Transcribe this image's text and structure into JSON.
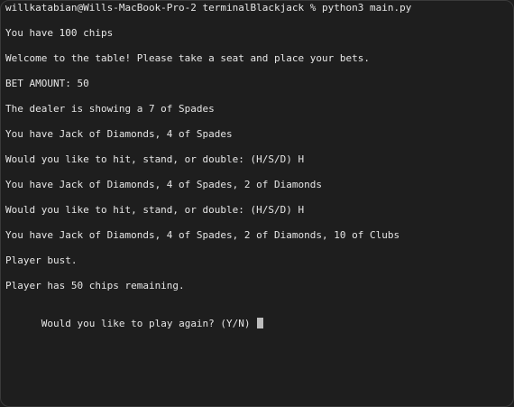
{
  "terminal": {
    "prompt": "willkatabian@Wills-MacBook-Pro-2 terminalBlackjack % python3 main.py",
    "lines": [
      "You have 100 chips",
      "Welcome to the table! Please take a seat and place your bets.",
      "BET AMOUNT: 50",
      "The dealer is showing a 7 of Spades",
      "You have Jack of Diamonds, 4 of Spades",
      "Would you like to hit, stand, or double: (H/S/D) H",
      "You have Jack of Diamonds, 4 of Spades, 2 of Diamonds",
      "Would you like to hit, stand, or double: (H/S/D) H",
      "You have Jack of Diamonds, 4 of Spades, 2 of Diamonds, 10 of Clubs",
      "Player bust.",
      "Player has 50 chips remaining.",
      "Would you like to play again? (Y/N) "
    ]
  }
}
